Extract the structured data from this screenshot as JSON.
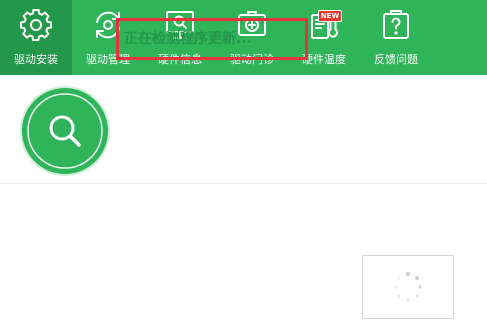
{
  "toolbar": {
    "tabs": [
      {
        "label": "驱动安装",
        "icon": "gear-icon",
        "active": true
      },
      {
        "label": "驱动管理",
        "icon": "refresh-gear-icon",
        "active": false
      },
      {
        "label": "硬件信息",
        "icon": "monitor-search-icon",
        "active": false
      },
      {
        "label": "驱动门诊",
        "icon": "medical-kit-icon",
        "active": false
      },
      {
        "label": "硬件温度",
        "icon": "thermometer-icon",
        "active": false,
        "badge": "NEW"
      },
      {
        "label": "反馈问题",
        "icon": "feedback-question-icon",
        "active": false
      }
    ]
  },
  "status": {
    "icon": "magnifier-icon",
    "text": "正在检测程序更新..."
  },
  "loader": {
    "icon": "loading-spinner-icon"
  },
  "colors": {
    "brand_green": "#2fb45a",
    "active_tab": "#23974a",
    "highlight_red": "#e8323c"
  }
}
